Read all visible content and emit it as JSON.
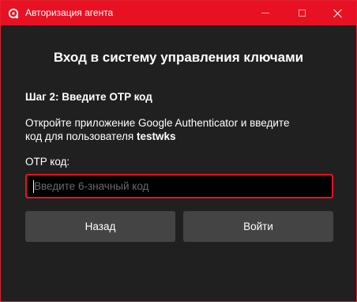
{
  "window": {
    "title": "Авторизация агента",
    "accent_color": "#e81123",
    "app_icon": "agent-logo-icon",
    "controls": {
      "minimize_icon": "minimize-icon",
      "maximize_icon": "maximize-icon",
      "close_icon": "close-icon"
    }
  },
  "main": {
    "heading": "Вход в систему управления ключами",
    "step": "Шаг 2: Введите OTP код",
    "description_line1": "Откройте приложение Google Authenticator и введите",
    "description_line2_prefix": "код для пользователя ",
    "username": "testwks",
    "otp_label": "OTP код:",
    "otp_input": {
      "value": "",
      "placeholder": "Введите 6-значный код"
    },
    "back_button": "Назад",
    "login_button": "Войти"
  }
}
